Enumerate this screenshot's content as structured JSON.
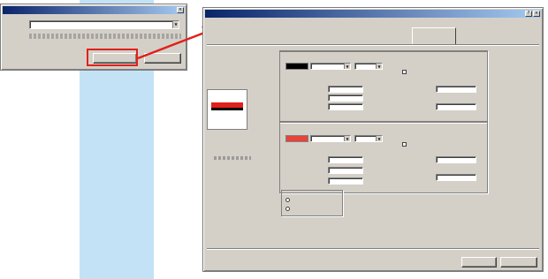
{
  "small_dialog": {
    "title": "",
    "row1_label": "",
    "row1_value": "",
    "row2_label": "",
    "row2_value": "",
    "ok_label": "",
    "cancel_label": ""
  },
  "main_dialog": {
    "title": "",
    "tabs": [
      "",
      "",
      "",
      "",
      "",
      "",
      ""
    ],
    "group1_label": "",
    "group2_label": "",
    "group3_label": "",
    "ok_label": "",
    "cancel_label": ""
  },
  "colors": {
    "highlight_red": "#e0201c",
    "swatch_black": "#000000",
    "swatch_red": "#e8423a",
    "side_strip": "#c3e2f6",
    "title_bar": "#0a246a"
  },
  "icons": [
    "arrow-icon",
    "close-icon",
    "combo-arrow-icon"
  ]
}
